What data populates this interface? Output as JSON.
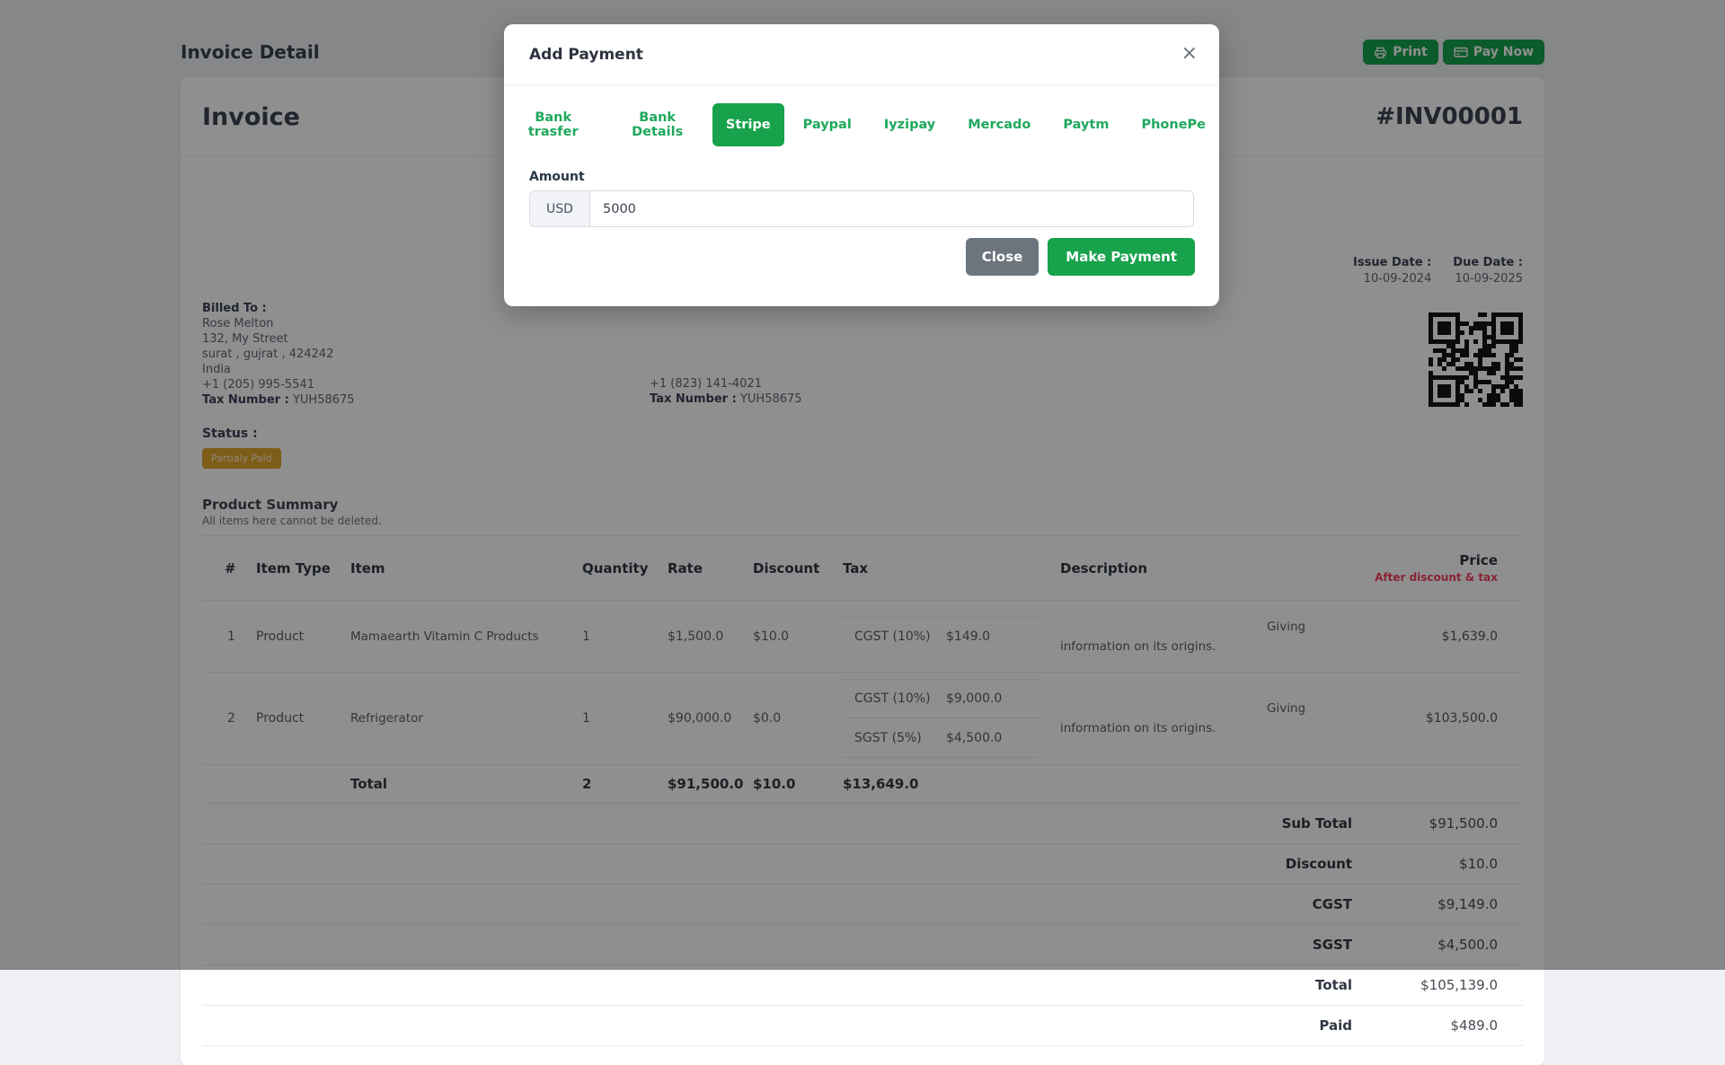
{
  "page": {
    "title": "Invoice Detail",
    "print_label": "Print",
    "pay_now_label": "Pay Now"
  },
  "colors": {
    "accent_green": "#17a24b",
    "tab_green": "#1fa85c",
    "price_note_red": "#f43f5e",
    "status_orange": "#e1a62c",
    "close_gray": "#6c757d"
  },
  "invoice": {
    "title": "Invoice",
    "number": "#INV00001",
    "issue_date_label": "Issue Date :",
    "issue_date": "10-09-2024",
    "due_date_label": "Due Date :",
    "due_date": "10-09-2025",
    "billed_to": {
      "label": "Billed To :",
      "name": "Rose Melton",
      "address1": "132, My Street",
      "address2": "surat , gujrat , 424242",
      "country": "India",
      "phone": "+1 (205) 995-5541",
      "tax_label": "Tax Number :",
      "tax_number": "YUH58675"
    },
    "shipped_to_visible": {
      "phone": "+1 (823) 141-4021",
      "tax_label": "Tax Number :",
      "tax_number": "YUH58675"
    },
    "status_label": "Status :",
    "status_badge": "Partialy Paid",
    "qr_icon": "qr-code"
  },
  "product_summary": {
    "title": "Product Summary",
    "subtitle": "All items here cannot be deleted.",
    "columns": [
      "#",
      "Item Type",
      "Item",
      "Quantity",
      "Rate",
      "Discount",
      "Tax",
      "Description",
      "Price"
    ],
    "price_subnote": "After discount & tax",
    "rows": [
      {
        "num": "1",
        "type": "Product",
        "item": "Mamaearth Vitamin C Products",
        "qty": "1",
        "rate": "$1,500.0",
        "discount": "$10.0",
        "taxes": [
          {
            "name": "CGST (10%)",
            "value": "$149.0"
          }
        ],
        "description": "Giving information on its origins.",
        "price": "$1,639.0"
      },
      {
        "num": "2",
        "type": "Product",
        "item": "Refrigerator",
        "qty": "1",
        "rate": "$90,000.0",
        "discount": "$0.0",
        "taxes": [
          {
            "name": "CGST (10%)",
            "value": "$9,000.0"
          },
          {
            "name": "SGST (5%)",
            "value": "$4,500.0"
          }
        ],
        "description": "Giving information on its origins.",
        "price": "$103,500.0"
      }
    ],
    "total_row": {
      "label": "Total",
      "qty": "2",
      "rate": "$91,500.0",
      "discount": "$10.0",
      "tax": "$13,649.0"
    },
    "summary": [
      {
        "label": "Sub Total",
        "value": "$91,500.0"
      },
      {
        "label": "Discount",
        "value": "$10.0"
      },
      {
        "label": "CGST",
        "value": "$9,149.0"
      },
      {
        "label": "SGST",
        "value": "$4,500.0"
      },
      {
        "label": "Total",
        "value": "$105,139.0"
      },
      {
        "label": "Paid",
        "value": "$489.0"
      }
    ]
  },
  "modal": {
    "title": "Add Payment",
    "close_icon": "×",
    "tabs": [
      {
        "label": "Bank trasfer",
        "active": false
      },
      {
        "label": "Bank Details",
        "active": false
      },
      {
        "label": "Stripe",
        "active": true
      },
      {
        "label": "Paypal",
        "active": false
      },
      {
        "label": "Iyzipay",
        "active": false
      },
      {
        "label": "Mercado",
        "active": false
      },
      {
        "label": "Paytm",
        "active": false
      },
      {
        "label": "PhonePe",
        "active": false
      }
    ],
    "amount_label": "Amount",
    "currency": "USD",
    "amount_value": "5000",
    "close_label": "Close",
    "submit_label": "Make Payment"
  }
}
